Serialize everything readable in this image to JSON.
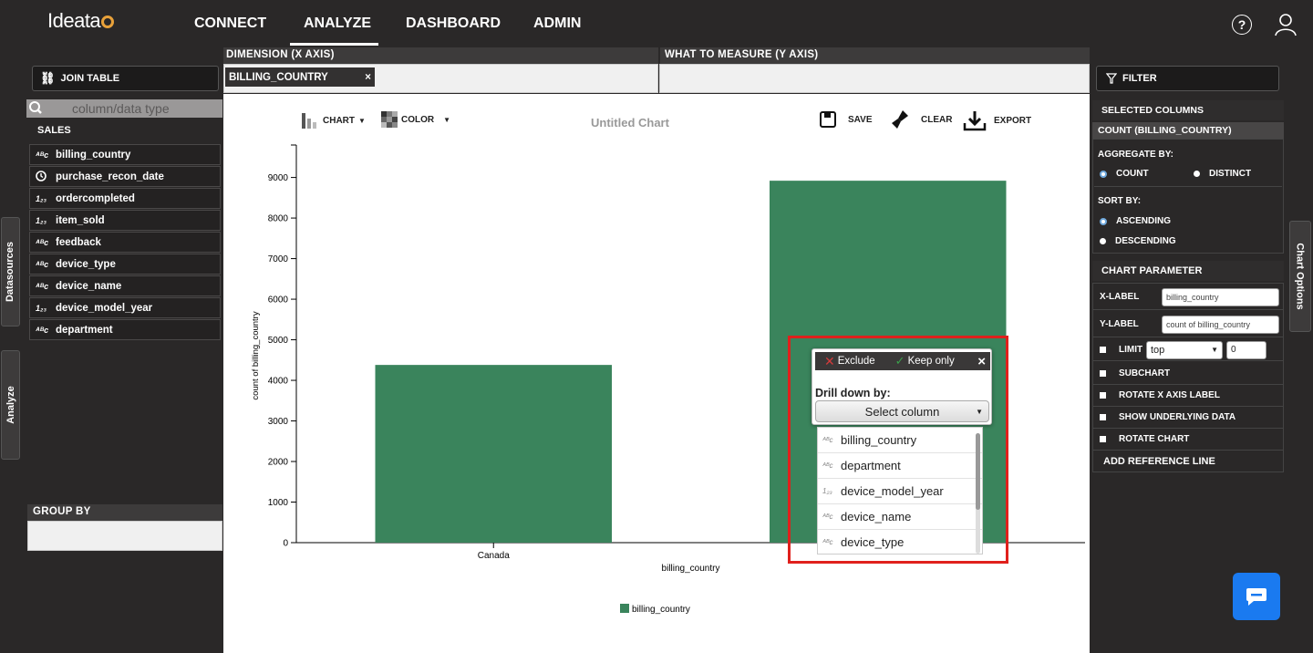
{
  "nav": {
    "logo": "Ideata",
    "items": [
      "CONNECT",
      "ANALYZE",
      "DASHBOARD",
      "ADMIN"
    ],
    "active": "ANALYZE",
    "help_icon": "?",
    "user_icon": "user-icon"
  },
  "left": {
    "join_table": "JOIN TABLE",
    "search_placeholder": "column/data type",
    "table_name": "SALES",
    "columns": [
      {
        "type": "abc",
        "label": "billing_country"
      },
      {
        "type": "clock",
        "label": "purchase_recon_date"
      },
      {
        "type": "123",
        "label": "ordercompleted"
      },
      {
        "type": "123",
        "label": "item_sold"
      },
      {
        "type": "abc",
        "label": "feedback"
      },
      {
        "type": "abc",
        "label": "device_type"
      },
      {
        "type": "abc",
        "label": "device_name"
      },
      {
        "type": "123",
        "label": "device_model_year"
      },
      {
        "type": "abc",
        "label": "department"
      }
    ],
    "group_by": "GROUP BY",
    "tab_datasources": "Datasources",
    "tab_analyze": "Analyze"
  },
  "dimension": {
    "header": "DIMENSION (X AXIS)",
    "chip": "BILLING_COUNTRY",
    "chip_close": "×"
  },
  "measure": {
    "header": "WHAT TO MEASURE (Y AXIS)"
  },
  "toolbar": {
    "chart": "CHART",
    "color": "COLOR",
    "title": "Untitled Chart",
    "save": "SAVE",
    "clear": "CLEAR",
    "export": "EXPORT"
  },
  "chart_data": {
    "type": "bar",
    "categories": [
      "Canada",
      ""
    ],
    "values": [
      4380,
      8920
    ],
    "xlabel": "billing_country",
    "ylabel": "count of billing_country",
    "yticks": [
      0,
      1000,
      2000,
      3000,
      4000,
      5000,
      6000,
      7000,
      8000,
      9000
    ],
    "ylim": [
      0,
      9800
    ],
    "legend": "billing_country",
    "color": "#3a845c"
  },
  "popup": {
    "exclude": "Exclude",
    "keep_only": "Keep only",
    "close": "×",
    "drill_label": "Drill down by:",
    "select_placeholder": "Select column",
    "options": [
      {
        "type": "abc",
        "label": "billing_country"
      },
      {
        "type": "abc",
        "label": "department"
      },
      {
        "type": "123",
        "label": "device_model_year"
      },
      {
        "type": "abc",
        "label": "device_name"
      },
      {
        "type": "abc",
        "label": "device_type"
      }
    ]
  },
  "right": {
    "filter": "FILTER",
    "selected_columns": "SELECTED COLUMNS",
    "column_name": "COUNT (BILLING_COUNTRY)",
    "aggregate_by": "AGGREGATE BY:",
    "count": "COUNT",
    "distinct": "DISTINCT",
    "sort_by": "SORT BY:",
    "ascending": "ASCENDING",
    "descending": "DESCENDING",
    "chart_parameter": "CHART PARAMETER",
    "x_label": "X-LABEL",
    "x_label_value": "billing_country",
    "y_label": "Y-LABEL",
    "y_label_value": "count of billing_country",
    "limit": "LIMIT",
    "limit_select": "top",
    "limit_value": "0",
    "subchart": "SUBCHART",
    "rotate_x": "ROTATE X AXIS LABEL",
    "show_underlying": "SHOW UNDERLYING DATA",
    "rotate_chart": "ROTATE CHART",
    "add_ref": "ADD REFERENCE LINE",
    "tab_chart_options": "Chart Options"
  }
}
